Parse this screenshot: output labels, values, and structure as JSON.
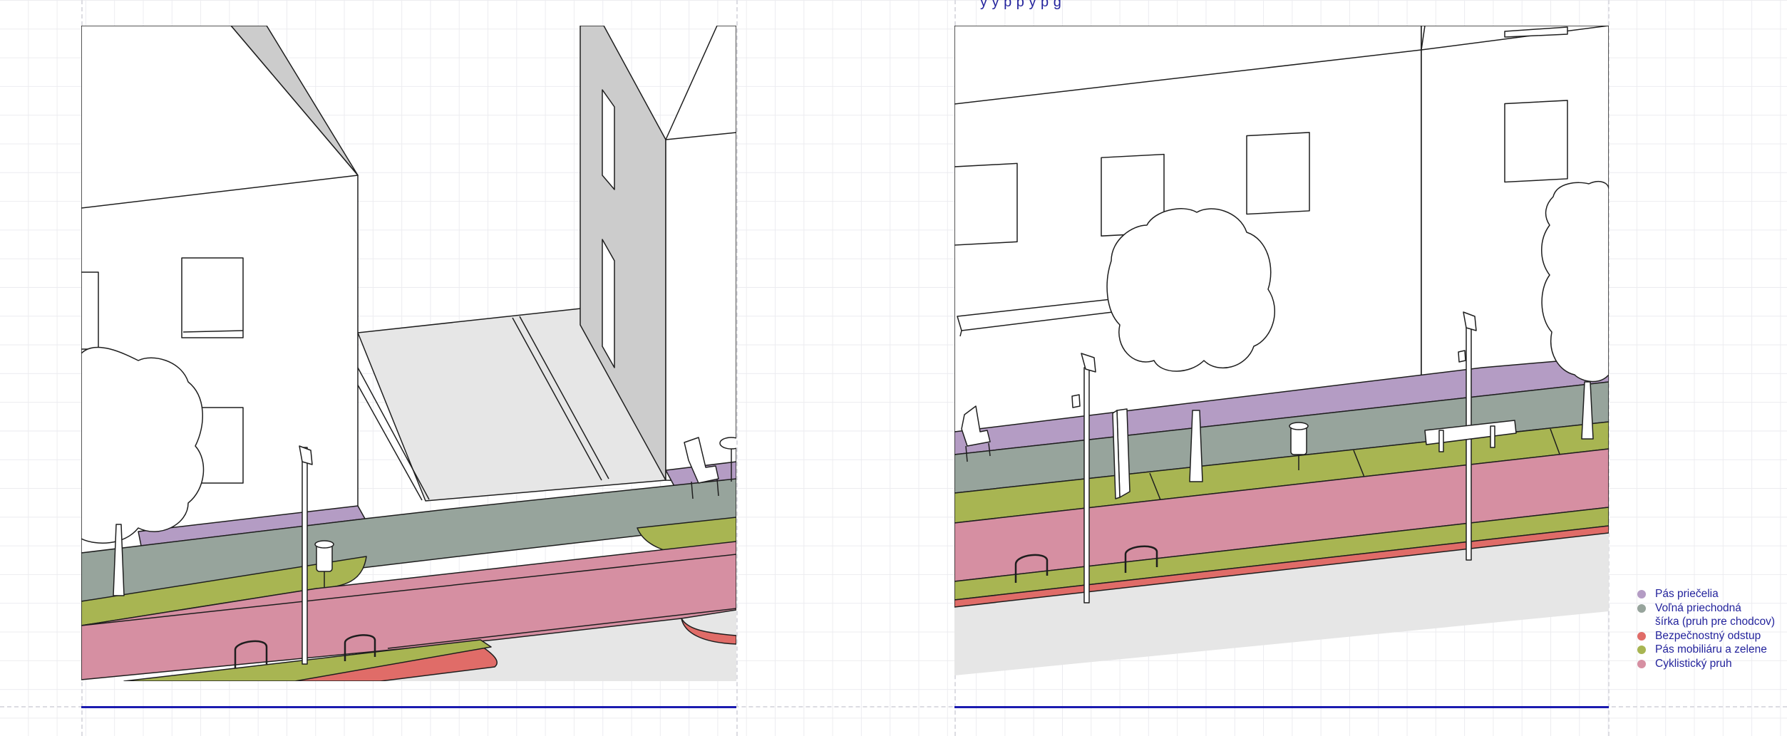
{
  "diagram": {
    "top_caption": "y          y       p           p                   y                 p          g",
    "legend": [
      {
        "id": "facade",
        "label_lines": [
          "Pás priečelia"
        ],
        "color": "#b49cc4"
      },
      {
        "id": "walk",
        "label_lines": [
          "Voľná priechodná",
          "šírka (pruh pre chodcov)"
        ],
        "color": "#97a49c"
      },
      {
        "id": "safety",
        "label_lines": [
          "Bezpečnostný odstup"
        ],
        "color": "#e06c68"
      },
      {
        "id": "furniture",
        "label_lines": [
          "Pás mobiliáru a zelene"
        ],
        "color": "#a8b552"
      },
      {
        "id": "cycle",
        "label_lines": [
          "Cyklistický pruh"
        ],
        "color": "#d68fa2"
      }
    ],
    "colors": {
      "line": "#1b1bb0",
      "building_shadow": "#cccccc",
      "road": "#e6e6e6"
    }
  }
}
